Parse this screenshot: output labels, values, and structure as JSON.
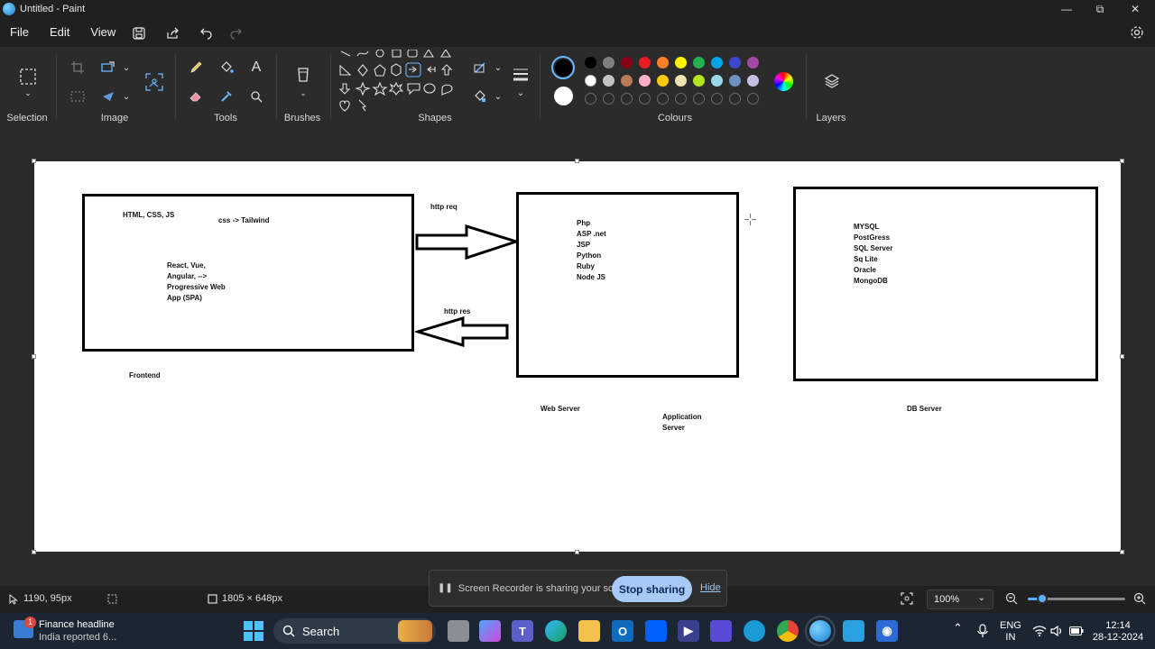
{
  "window": {
    "title": "Untitled - Paint",
    "controls": {
      "minimize": "—",
      "maximize": "⧉",
      "close": "✕"
    }
  },
  "menu": [
    "File",
    "Edit",
    "View"
  ],
  "ribbon": {
    "groups": {
      "selection": "Selection",
      "image": "Image",
      "tools": "Tools",
      "brushes": "Brushes",
      "shapes": "Shapes",
      "colours": "Colours",
      "layers": "Layers"
    },
    "palette_row1": [
      "#000000",
      "#7f7f7f",
      "#880015",
      "#ed1c24",
      "#ff7f27",
      "#fff200",
      "#22b14c",
      "#00a2e8",
      "#3f48cc",
      "#a349a4"
    ],
    "palette_row2": [
      "#ffffff",
      "#c3c3c3",
      "#b97a57",
      "#ffaec9",
      "#ffc90e",
      "#efe4b0",
      "#b5e61d",
      "#99d9ea",
      "#7092be",
      "#c8bfe7"
    ],
    "primary_color": "#000000",
    "secondary_color": "#ffffff"
  },
  "canvas": {
    "frontend_box": {
      "line1": "HTML, CSS, JS",
      "line2": "css -> Tailwind",
      "lines": [
        "React, Vue,",
        "Angular, -->",
        "Progressive Web",
        "App (SPA)"
      ]
    },
    "frontend_label": "Frontend",
    "http_req": "http req",
    "http_res": "http res",
    "web_box_lines": [
      "Php",
      "ASP .net",
      "JSP",
      "Python",
      "Ruby",
      "Node JS"
    ],
    "web_server_label": "Web Server",
    "app_server_label": [
      "Application",
      "Server"
    ],
    "db_box_lines": [
      "MYSQL",
      "PostGress",
      "SQL Server",
      "Sq Lite",
      "Oracle",
      "MongoDB"
    ],
    "db_server_label": "DB Server"
  },
  "share_bar": {
    "message": "Screen Recorder is sharing your screen.",
    "stop_button": "Stop sharing",
    "hide_link": "Hide"
  },
  "status_bar": {
    "cursor_position": "1190, 95px",
    "canvas_size": "1805 × 648px",
    "zoom": "100%",
    "zoom_level_fraction": 0.15
  },
  "taskbar": {
    "news_badge": "1",
    "news_title": "Finance headline",
    "news_subtitle": "India reported 6...",
    "search_label": "Search",
    "language": [
      "ENG",
      "IN"
    ],
    "time": "12:14",
    "date": "28-12-2024"
  }
}
